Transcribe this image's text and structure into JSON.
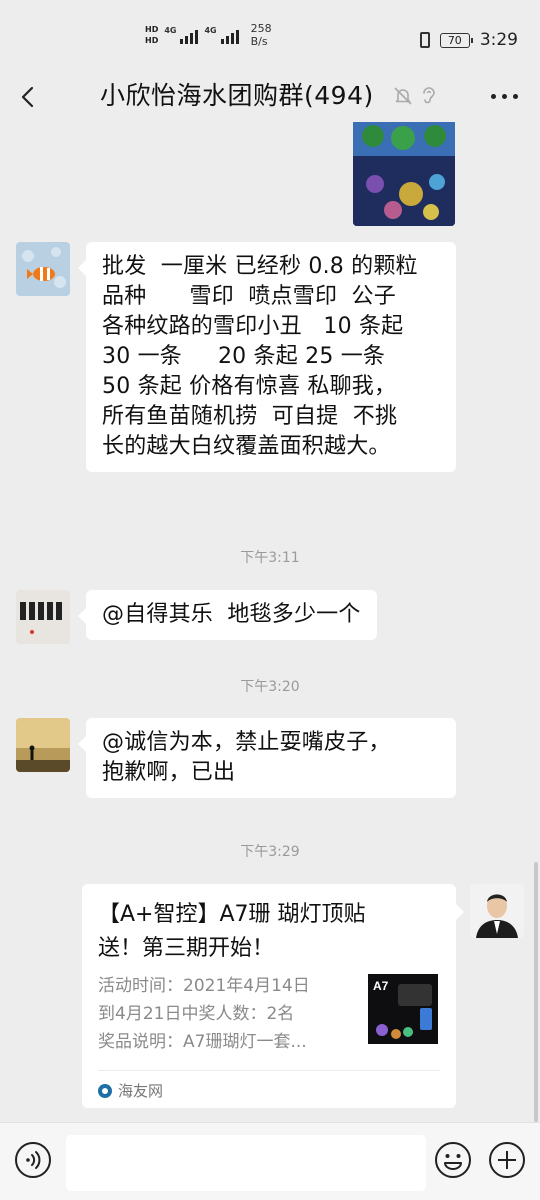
{
  "status_bar": {
    "hd_label": "HD",
    "net_label_1": "4G",
    "net_label_2": "4G",
    "speed_value": "258",
    "speed_unit": "B/s",
    "battery": "70",
    "time": "3:29"
  },
  "header": {
    "title": "小欣怡海水团购群(494)"
  },
  "messages": {
    "m1": {
      "lines": [
        "批发  一厘米 已经秒 0.8 的颗粒",
        "品种      雪印  喷点雪印  公子",
        "各种纹路的雪印小丑   10 条起",
        "30 一条     20 条起 25 一条",
        "50 条起 价格有惊喜 私聊我，",
        "所有鱼苗随机捞  可自提  不挑",
        "长的越大白纹覆盖面积越大。"
      ]
    },
    "t1": "下午3:11",
    "m2": {
      "text": "@自得其乐  地毯多少一个"
    },
    "t2": "下午3:20",
    "m3": {
      "lines": [
        "@诚信为本，禁止耍嘴皮子，",
        "抱歉啊，已出"
      ]
    },
    "t3": "下午3:29",
    "card": {
      "title_line1": "【A+智控】A7珊 瑚灯顶贴",
      "title_line2": "送！第三期开始！",
      "desc_line1": "活动时间：2021年4月14日",
      "desc_line2": "到4月21日中奖人数：2名",
      "desc_line3": "奖品说明：A7珊瑚灯一套...",
      "thumb_label": "A7",
      "source": "海友网"
    }
  },
  "colors": {
    "background": "#ededed",
    "bubble": "#ffffff",
    "timestamp": "#9a9a9a"
  }
}
